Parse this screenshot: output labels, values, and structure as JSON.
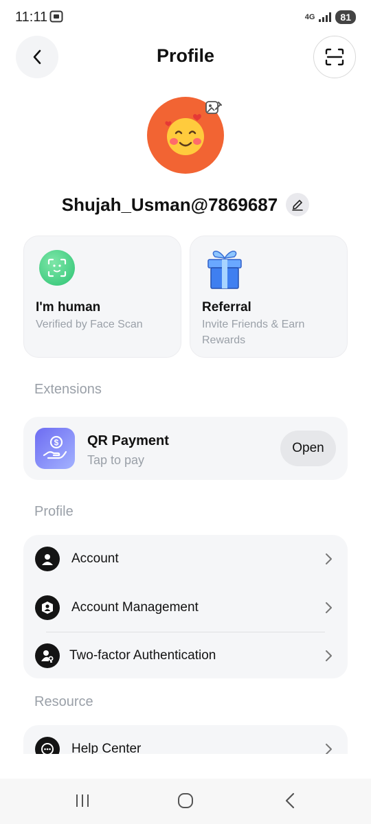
{
  "status_bar": {
    "time": "11:11",
    "network_top": "4G",
    "battery": "81"
  },
  "header": {
    "title": "Profile",
    "back_icon": "chevron-left-icon",
    "scan_icon": "scan-frame-icon"
  },
  "profile": {
    "avatar_emoji": "🥰",
    "avatar_color": "#f26433",
    "username": "Shujah_Usman@7869687"
  },
  "cards": {
    "human": {
      "title": "I'm human",
      "subtitle": "Verified by Face Scan"
    },
    "referral": {
      "title": "Referral",
      "subtitle": "Invite Friends & Earn Rewards"
    }
  },
  "extensions": {
    "section_title": "Extensions",
    "qr_payment": {
      "title": "QR Payment",
      "subtitle": "Tap to pay",
      "button": "Open"
    }
  },
  "profile_section": {
    "section_title": "Profile",
    "items": [
      {
        "label": "Account",
        "icon": "user-icon"
      },
      {
        "label": "Account Management",
        "icon": "user-badge-icon"
      },
      {
        "label": "Two-factor Authentication",
        "icon": "user-key-icon"
      }
    ]
  },
  "resource_section": {
    "section_title": "Resource",
    "items": [
      {
        "label": "Help Center",
        "icon": "chat-support-icon"
      }
    ]
  },
  "colors": {
    "accent_green": "#2cc373",
    "qr_gradient": "#6d6cf2"
  }
}
